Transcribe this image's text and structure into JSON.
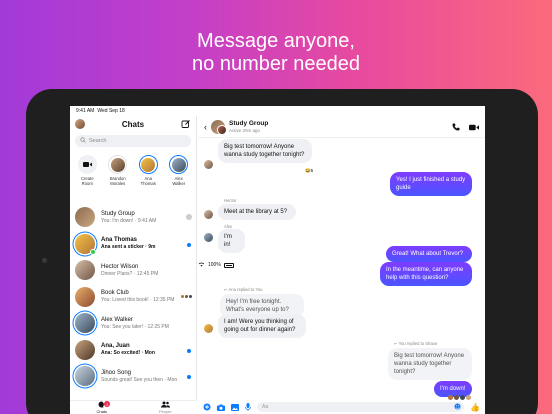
{
  "headline": {
    "line1": "Message anyone,",
    "line2": "no number needed"
  },
  "status_bar": {
    "time": "9:41 AM",
    "date": "Wed Sep 18"
  },
  "chats": {
    "title": "Chats",
    "search_placeholder": "Search",
    "stories": [
      {
        "label": "Create\nRoom"
      },
      {
        "label": "Brandon\nMorales"
      },
      {
        "label": "Ana\nThomas"
      },
      {
        "label": "Alex\nWalker"
      }
    ],
    "rows": [
      {
        "name": "Study Group",
        "preview": "You: I'm down! · 9:41 AM",
        "bold": false
      },
      {
        "name": "Ana Thomas",
        "preview": "Ana sent a sticker · 9m",
        "bold": true
      },
      {
        "name": "Hector Wilson",
        "preview": "Dinner Plans? · 12:45 PM",
        "bold": false
      },
      {
        "name": "Book Club",
        "preview": "You: Loved this book! · 12:35 PM",
        "bold": false
      },
      {
        "name": "Alex Walker",
        "preview": "You: See you later! · 12:25 PM",
        "bold": false
      },
      {
        "name": "Ana, Juan",
        "preview": "Ana: So excited! · Mon",
        "bold": true
      },
      {
        "name": "Jihoo Song",
        "preview": "Sounds great! See you then · Mon",
        "bold": false
      }
    ],
    "tabs": [
      {
        "label": "Chats",
        "badge": "2"
      },
      {
        "label": "People"
      }
    ]
  },
  "conversation": {
    "title": "Study Group",
    "subtitle": "Active 20m ago",
    "messages": {
      "m1": "Big test tomorrow! Anyone wanna study together tonight?",
      "m2": "Yes! I just finished a study guide",
      "m3_sender": "Hector",
      "m3": "Meet at the library at 5?",
      "m4_sender": "Alex",
      "m4": "I'm in!",
      "m5": "Great! What about Trevor?",
      "m6": "In the meantime, can anyone help with this question?",
      "m7_note": "Ana replied to You",
      "m7_quote": "Hey! I'm free tonight. What's everyone up to?",
      "m7": "I am! Were you thinking of going out for dinner again?",
      "m8_note": "You replied to Shane",
      "m8_quote": "Big test tomorrow! Anyone wanna study together tonight?",
      "m9": "I'm down!",
      "reaction": "👍",
      "reaction_count": "5"
    },
    "composer_placeholder": "Aa"
  },
  "colors": {
    "accent": "#0a7cff",
    "bubble_out": "#6e3bff",
    "bg_start": "#a23ad8",
    "bg_end": "#fb6a7c"
  }
}
